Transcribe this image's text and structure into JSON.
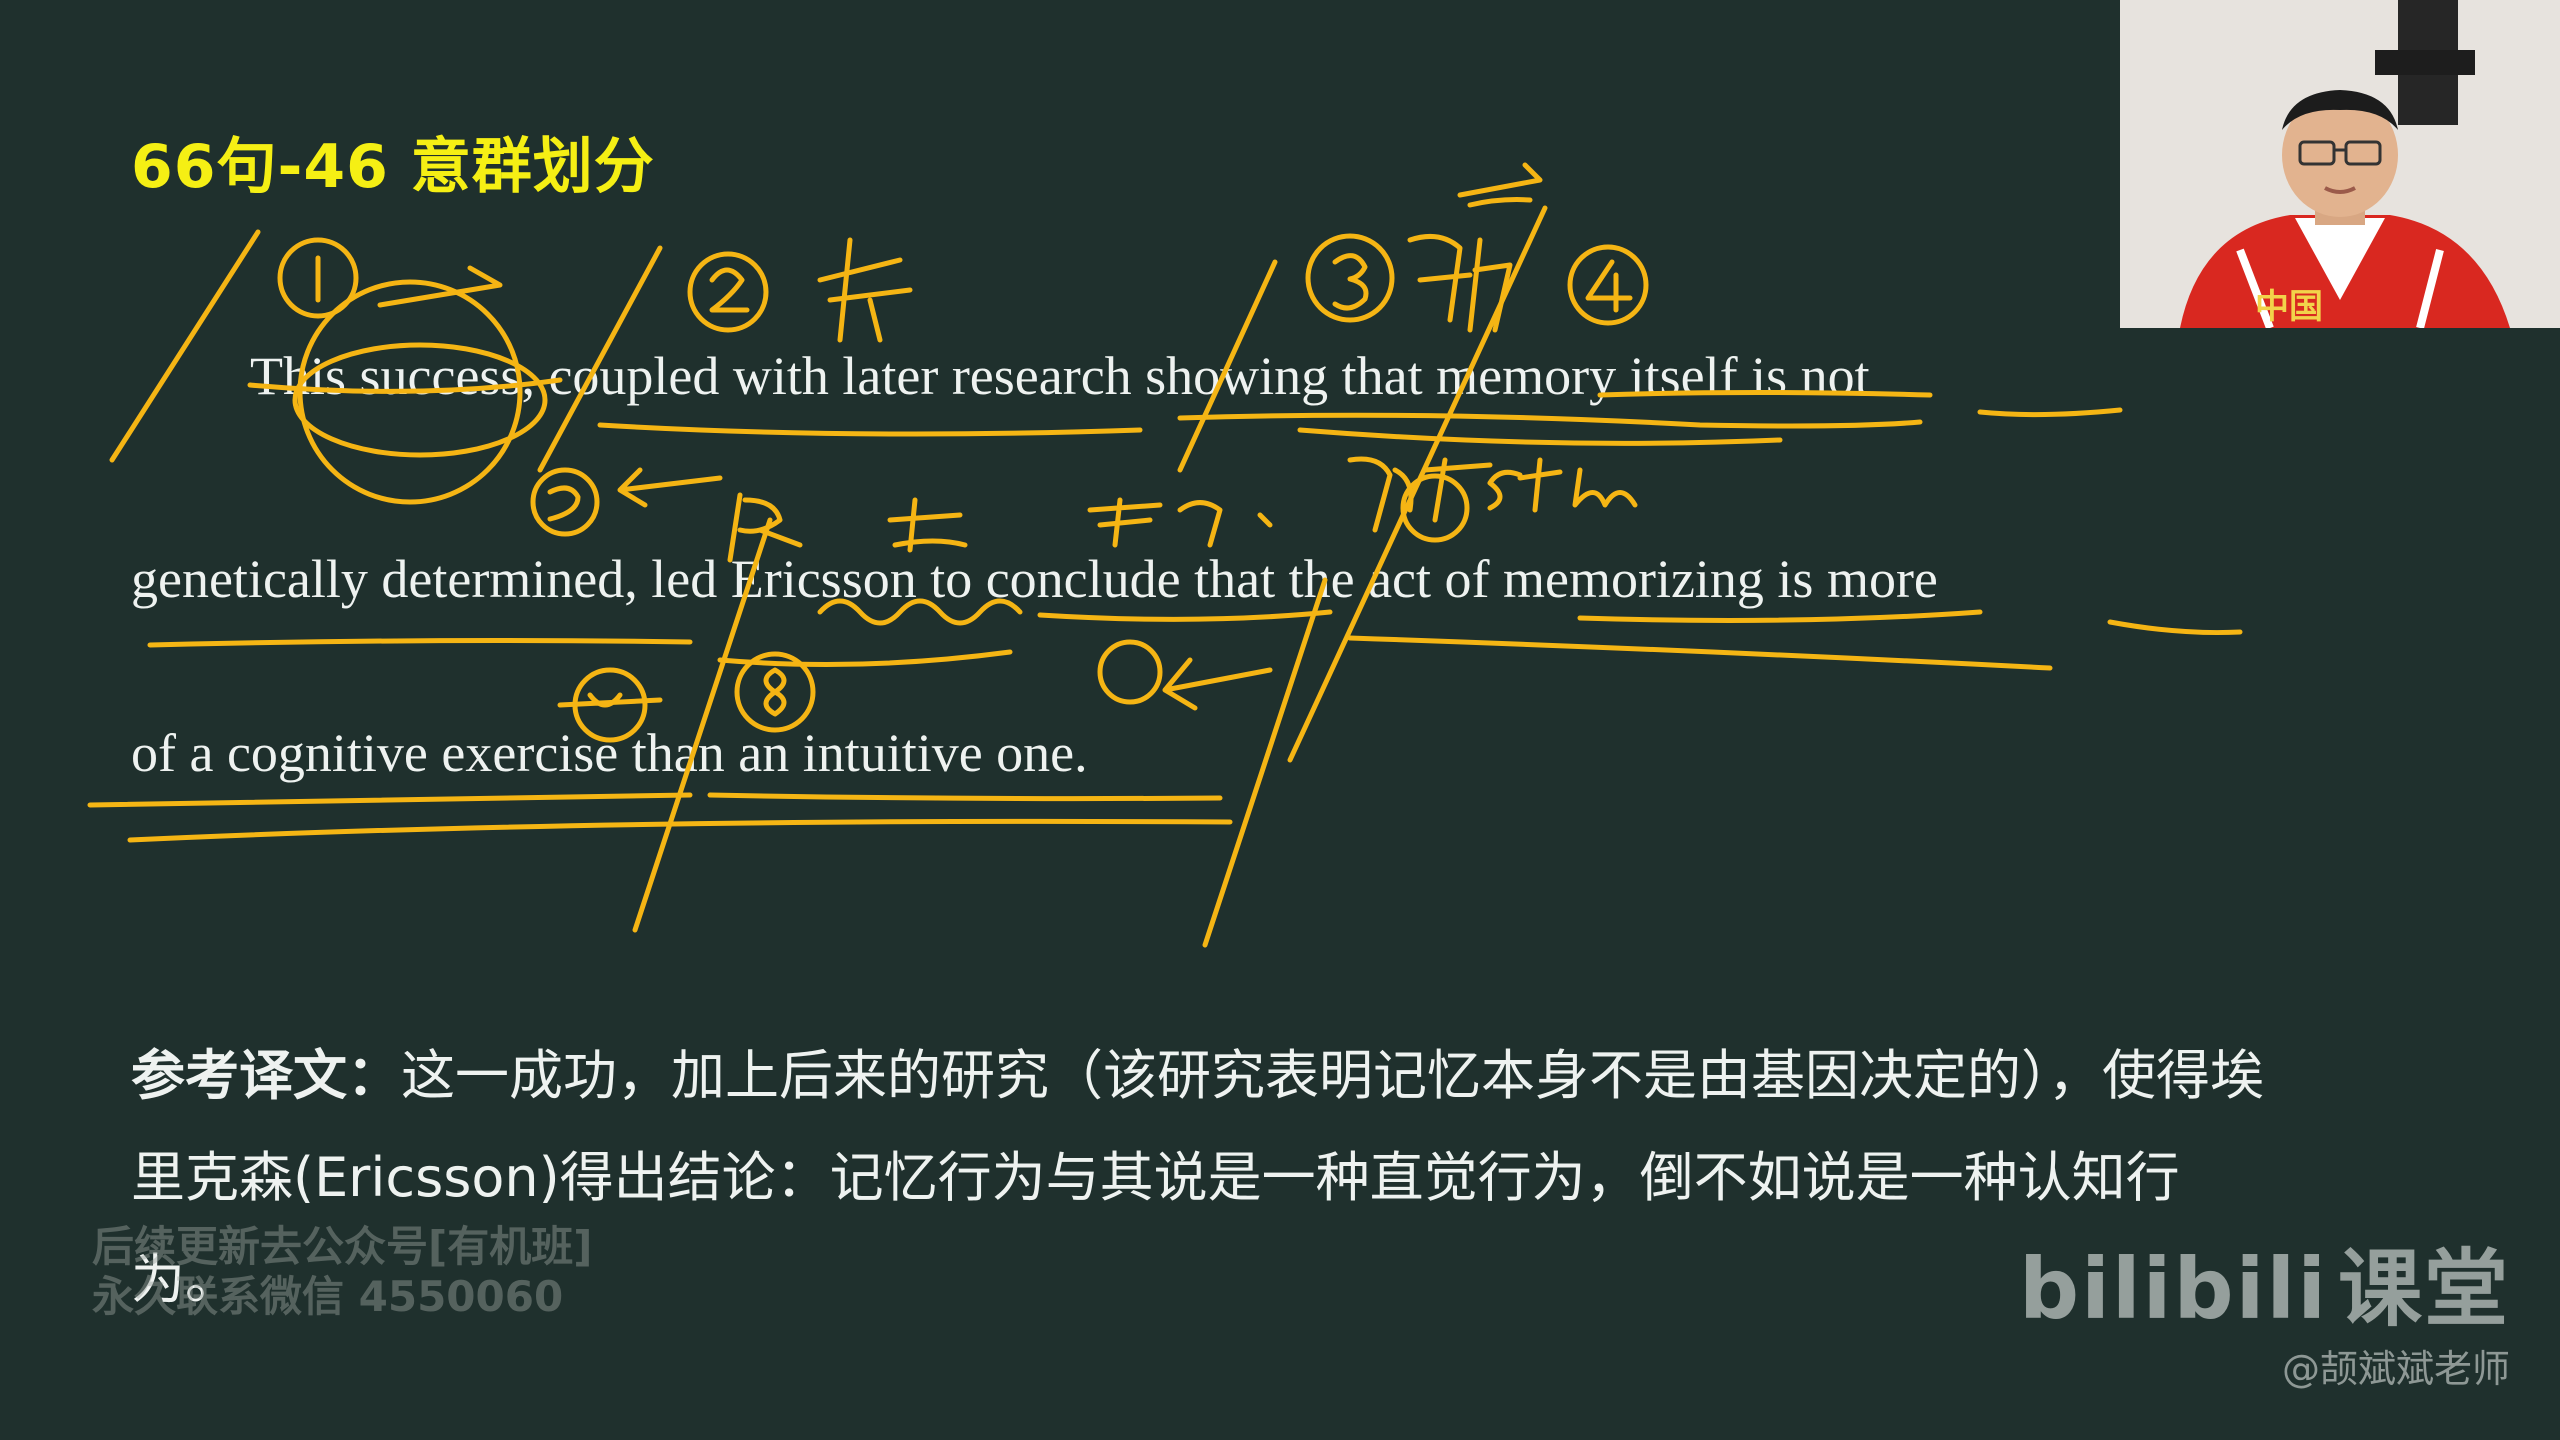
{
  "slide": {
    "title": "66句-46 意群划分",
    "sentence_lines": [
      "This success, coupled with later research showing that memory itself is not",
      "genetically determined, led Ericsson to conclude that the act of memorizing is more",
      "of a cognitive exercise than an intuitive one."
    ],
    "translation_label": "参考译文：",
    "translation_text": "这一成功，加上后来的研究（该研究表明记忆本身不是由基因决定的），使得埃里克森(Ericsson)得出结论：记忆行为与其说是一种直觉行为，倒不如说是一种认知行为。"
  },
  "annotations": {
    "ink_color": "#f5b514",
    "marks": [
      "①",
      "②",
      "主",
      "③",
      "被",
      "④",
      "⑤",
      "⑥",
      "⑦",
      "⑧"
    ]
  },
  "watermark": {
    "ad_line1": "后续更新去公众号[有机班]",
    "ad_line2": "永久联系微信 4550060",
    "brand_logo": "bilibili",
    "brand_course": "课堂",
    "author": "@颉斌斌老师"
  },
  "webcam": {
    "shirt_text": "中国"
  },
  "colors": {
    "background": "#1f302d",
    "title": "#f5ef14",
    "text": "#eef2f0"
  }
}
